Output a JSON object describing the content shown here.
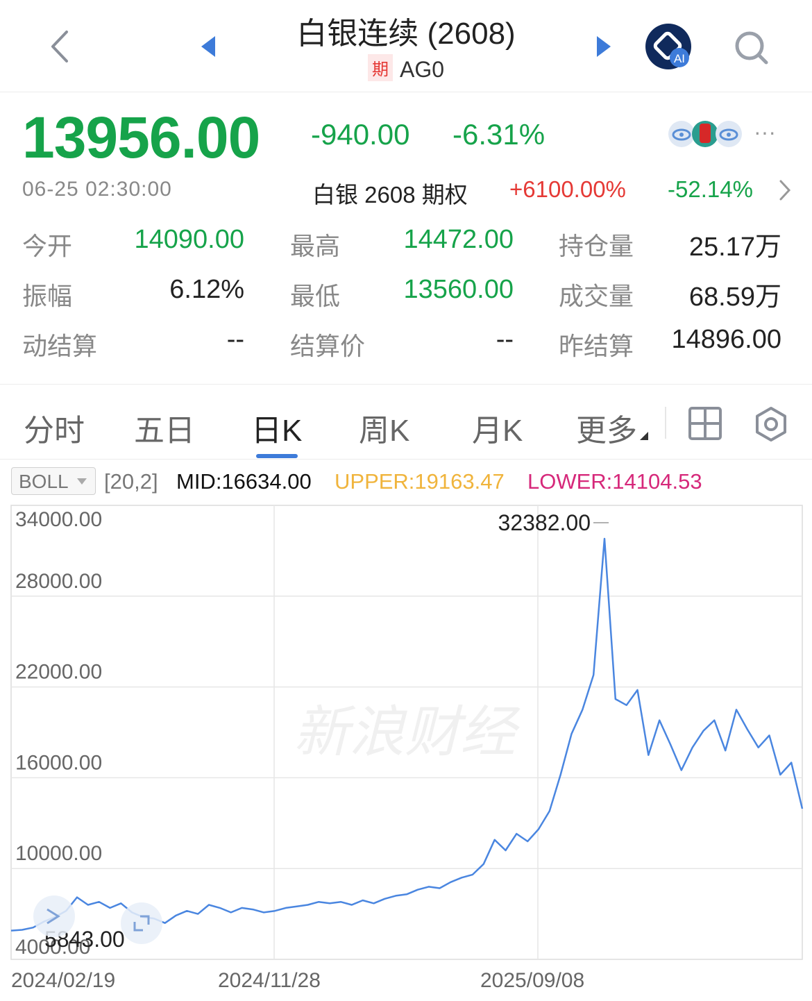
{
  "header": {
    "title": "白银连续 (2608)",
    "badge": "期",
    "code": "AG0"
  },
  "quote": {
    "price": "13956.00",
    "change": "-940.00",
    "change_pct": "-6.31%",
    "time": "06-25 02:30:00",
    "option_label": "白银 2608 期权",
    "option_up": "+6100.00%",
    "option_down": "-52.14%",
    "more": "···"
  },
  "stats": [
    {
      "label": "今开",
      "value": "14090.00",
      "color": "#16a34a"
    },
    {
      "label": "最高",
      "value": "14472.00",
      "color": "#16a34a"
    },
    {
      "label": "持仓量",
      "value": "25.17万",
      "color": "#222222"
    },
    {
      "label": "振幅",
      "value": "6.12%",
      "color": "#222222"
    },
    {
      "label": "最低",
      "value": "13560.00",
      "color": "#16a34a"
    },
    {
      "label": "成交量",
      "value": "68.59万",
      "color": "#222222"
    },
    {
      "label": "动结算",
      "value": "--",
      "color": "#222222"
    },
    {
      "label": "结算价",
      "value": "--",
      "color": "#222222"
    },
    {
      "label": "昨结算",
      "value": "14896.00",
      "color": "#222222"
    }
  ],
  "tabs": [
    "分时",
    "五日",
    "日K",
    "周K",
    "月K",
    "更多"
  ],
  "active_tab": "日K",
  "indicator": {
    "name": "BOLL",
    "params": "[20,2]",
    "mid": "MID:16634.00",
    "upper": "UPPER:19163.47",
    "lower": "LOWER:14104.53",
    "mid_color": "#111111",
    "upper_color": "#f0b43c",
    "lower_color": "#d6287a"
  },
  "watermark": "新浪财经",
  "chart_data": {
    "type": "line",
    "yticks": [
      "34000.00",
      "28000.00",
      "22000.00",
      "16000.00",
      "10000.00",
      "4000.00"
    ],
    "ylim": [
      4000,
      34000
    ],
    "xticks": [
      "2024/02/19",
      "2024/11/28",
      "2025/09/08"
    ],
    "max_label": "32382.00",
    "min_label": "5843.00",
    "line_color": "#4a86e0",
    "series": [
      {
        "values": [
          5900,
          5950,
          6100,
          6500,
          6800,
          7200,
          8100,
          7600,
          7800,
          7400,
          7700,
          7100,
          6800,
          6700,
          6400,
          6900,
          7200,
          7000,
          7600,
          7400,
          7100,
          7400,
          7300,
          7100,
          7200,
          7400,
          7500,
          7600,
          7800,
          7700,
          7800,
          7600,
          7900,
          7700,
          8000,
          8200,
          8300,
          8600,
          8800,
          8700,
          9100,
          9400,
          9600,
          10300,
          11900,
          11200,
          12300,
          11800,
          12600,
          13800,
          16200,
          18900,
          20500,
          22800,
          31800,
          21200,
          20800,
          21800,
          17500,
          19800,
          18200,
          16500,
          18000,
          19100,
          19800,
          17800,
          20500,
          19200,
          18000,
          18800,
          16200,
          17000,
          13956
        ]
      }
    ]
  }
}
